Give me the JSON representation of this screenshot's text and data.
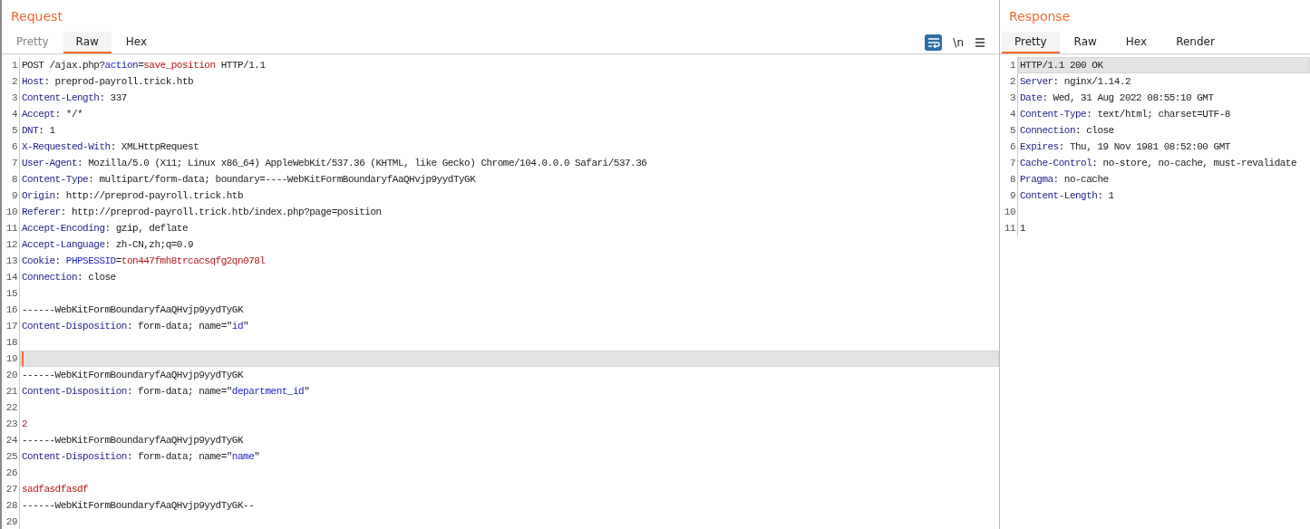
{
  "request": {
    "title": "Request",
    "tabs": [
      {
        "label": "Pretty",
        "selected": false,
        "disabled": true
      },
      {
        "label": "Raw",
        "selected": true,
        "disabled": false
      },
      {
        "label": "Hex",
        "selected": false,
        "disabled": false
      }
    ],
    "toolbar": {
      "wrap_on": true,
      "newline_label": "\\n"
    },
    "lines": [
      {
        "n": "1",
        "selected": false,
        "segs": [
          {
            "kind": "plain",
            "text": "POST /ajax.php?"
          },
          {
            "kind": "param",
            "text": "action"
          },
          {
            "kind": "plain",
            "text": "="
          },
          {
            "kind": "value",
            "text": "save_position"
          },
          {
            "kind": "plain",
            "text": " HTTP/1.1"
          }
        ]
      },
      {
        "n": "2",
        "selected": false,
        "segs": [
          {
            "kind": "key",
            "text": "Host"
          },
          {
            "kind": "plain",
            "text": ": preprod-payroll.trick.htb"
          }
        ]
      },
      {
        "n": "3",
        "selected": false,
        "segs": [
          {
            "kind": "key",
            "text": "Content-Length"
          },
          {
            "kind": "plain",
            "text": ": 337"
          }
        ]
      },
      {
        "n": "4",
        "selected": false,
        "segs": [
          {
            "kind": "key",
            "text": "Accept"
          },
          {
            "kind": "plain",
            "text": ": */*"
          }
        ]
      },
      {
        "n": "5",
        "selected": false,
        "segs": [
          {
            "kind": "key",
            "text": "DNT"
          },
          {
            "kind": "plain",
            "text": ": 1"
          }
        ]
      },
      {
        "n": "6",
        "selected": false,
        "segs": [
          {
            "kind": "key",
            "text": "X-Requested-With"
          },
          {
            "kind": "plain",
            "text": ": XMLHttpRequest"
          }
        ]
      },
      {
        "n": "7",
        "selected": false,
        "segs": [
          {
            "kind": "key",
            "text": "User-Agent"
          },
          {
            "kind": "plain",
            "text": ": Mozilla/5.0 (X11; Linux x86_64) AppleWebKit/537.36 (KHTML, like Gecko) Chrome/104.0.0.0 Safari/537.36"
          }
        ]
      },
      {
        "n": "8",
        "selected": false,
        "segs": [
          {
            "kind": "key",
            "text": "Content-Type"
          },
          {
            "kind": "plain",
            "text": ": multipart/form-data; boundary=----WebKitFormBoundaryfAaQHvjp9yydTyGK"
          }
        ]
      },
      {
        "n": "9",
        "selected": false,
        "segs": [
          {
            "kind": "key",
            "text": "Origin"
          },
          {
            "kind": "plain",
            "text": ": http://preprod-payroll.trick.htb"
          }
        ]
      },
      {
        "n": "10",
        "selected": false,
        "segs": [
          {
            "kind": "key",
            "text": "Referer"
          },
          {
            "kind": "plain",
            "text": ": http://preprod-payroll.trick.htb/index.php?page=position"
          }
        ]
      },
      {
        "n": "11",
        "selected": false,
        "segs": [
          {
            "kind": "key",
            "text": "Accept-Encoding"
          },
          {
            "kind": "plain",
            "text": ": gzip, deflate"
          }
        ]
      },
      {
        "n": "12",
        "selected": false,
        "segs": [
          {
            "kind": "key",
            "text": "Accept-Language"
          },
          {
            "kind": "plain",
            "text": ": zh-CN,zh;q=0.9"
          }
        ]
      },
      {
        "n": "13",
        "selected": false,
        "segs": [
          {
            "kind": "key",
            "text": "Cookie"
          },
          {
            "kind": "plain",
            "text": ": "
          },
          {
            "kind": "param",
            "text": "PHPSESSID"
          },
          {
            "kind": "plain",
            "text": "="
          },
          {
            "kind": "value",
            "text": "ton447fmh8trcacsqfg2qn078l"
          }
        ]
      },
      {
        "n": "14",
        "selected": false,
        "segs": [
          {
            "kind": "key",
            "text": "Connection"
          },
          {
            "kind": "plain",
            "text": ": close"
          }
        ]
      },
      {
        "n": "15",
        "selected": false
      },
      {
        "n": "16",
        "selected": false,
        "segs": [
          {
            "kind": "plain",
            "text": "------WebKitFormBoundaryfAaQHvjp9yydTyGK"
          }
        ]
      },
      {
        "n": "17",
        "selected": false,
        "segs": [
          {
            "kind": "key",
            "text": "Content-Disposition"
          },
          {
            "kind": "plain",
            "text": ": form-data; name=\""
          },
          {
            "kind": "param",
            "text": "id"
          },
          {
            "kind": "plain",
            "text": "\""
          }
        ]
      },
      {
        "n": "18",
        "selected": false
      },
      {
        "n": "19",
        "selected": true
      },
      {
        "n": "20",
        "selected": false,
        "segs": [
          {
            "kind": "plain",
            "text": "------WebKitFormBoundaryfAaQHvjp9yydTyGK"
          }
        ]
      },
      {
        "n": "21",
        "selected": false,
        "segs": [
          {
            "kind": "key",
            "text": "Content-Disposition"
          },
          {
            "kind": "plain",
            "text": ": form-data; name=\""
          },
          {
            "kind": "param",
            "text": "department_id"
          },
          {
            "kind": "plain",
            "text": "\""
          }
        ]
      },
      {
        "n": "22",
        "selected": false
      },
      {
        "n": "23",
        "selected": false,
        "segs": [
          {
            "kind": "value",
            "text": "2"
          }
        ]
      },
      {
        "n": "24",
        "selected": false,
        "segs": [
          {
            "kind": "plain",
            "text": "------WebKitFormBoundaryfAaQHvjp9yydTyGK"
          }
        ]
      },
      {
        "n": "25",
        "selected": false,
        "segs": [
          {
            "kind": "key",
            "text": "Content-Disposition"
          },
          {
            "kind": "plain",
            "text": ": form-data; name=\""
          },
          {
            "kind": "param",
            "text": "name"
          },
          {
            "kind": "plain",
            "text": "\""
          }
        ]
      },
      {
        "n": "26",
        "selected": false
      },
      {
        "n": "27",
        "selected": false,
        "segs": [
          {
            "kind": "value",
            "text": "sadfasdfasdf"
          }
        ]
      },
      {
        "n": "28",
        "selected": false,
        "segs": [
          {
            "kind": "plain",
            "text": "------WebKitFormBoundaryfAaQHvjp9yydTyGK--"
          }
        ]
      },
      {
        "n": "29",
        "selected": false
      }
    ]
  },
  "response": {
    "title": "Response",
    "tabs": [
      {
        "label": "Pretty",
        "selected": true,
        "disabled": false
      },
      {
        "label": "Raw",
        "selected": false,
        "disabled": false
      },
      {
        "label": "Hex",
        "selected": false,
        "disabled": false
      },
      {
        "label": "Render",
        "selected": false,
        "disabled": false
      }
    ],
    "lines": [
      {
        "n": "1",
        "selected": true,
        "segs": [
          {
            "kind": "plain",
            "text": "HTTP/1.1 200 OK"
          }
        ]
      },
      {
        "n": "2",
        "selected": false,
        "segs": [
          {
            "kind": "key",
            "text": "Server"
          },
          {
            "kind": "plain",
            "text": ": nginx/1.14.2"
          }
        ]
      },
      {
        "n": "3",
        "selected": false,
        "segs": [
          {
            "kind": "key",
            "text": "Date"
          },
          {
            "kind": "plain",
            "text": ": Wed, 31 Aug 2022 08:55:10 GMT"
          }
        ]
      },
      {
        "n": "4",
        "selected": false,
        "segs": [
          {
            "kind": "key",
            "text": "Content-Type"
          },
          {
            "kind": "plain",
            "text": ": text/html; charset=UTF-8"
          }
        ]
      },
      {
        "n": "5",
        "selected": false,
        "segs": [
          {
            "kind": "key",
            "text": "Connection"
          },
          {
            "kind": "plain",
            "text": ": close"
          }
        ]
      },
      {
        "n": "6",
        "selected": false,
        "segs": [
          {
            "kind": "key",
            "text": "Expires"
          },
          {
            "kind": "plain",
            "text": ": Thu, 19 Nov 1981 08:52:00 GMT"
          }
        ]
      },
      {
        "n": "7",
        "selected": false,
        "segs": [
          {
            "kind": "key",
            "text": "Cache-Control"
          },
          {
            "kind": "plain",
            "text": ": no-store, no-cache, must-revalidate"
          }
        ]
      },
      {
        "n": "8",
        "selected": false,
        "segs": [
          {
            "kind": "key",
            "text": "Pragma"
          },
          {
            "kind": "plain",
            "text": ": no-cache"
          }
        ]
      },
      {
        "n": "9",
        "selected": false,
        "segs": [
          {
            "kind": "key",
            "text": "Content-Length"
          },
          {
            "kind": "plain",
            "text": ": 1"
          }
        ]
      },
      {
        "n": "10",
        "selected": false
      },
      {
        "n": "11",
        "selected": false,
        "segs": [
          {
            "kind": "plain",
            "text": "1"
          }
        ]
      }
    ]
  }
}
